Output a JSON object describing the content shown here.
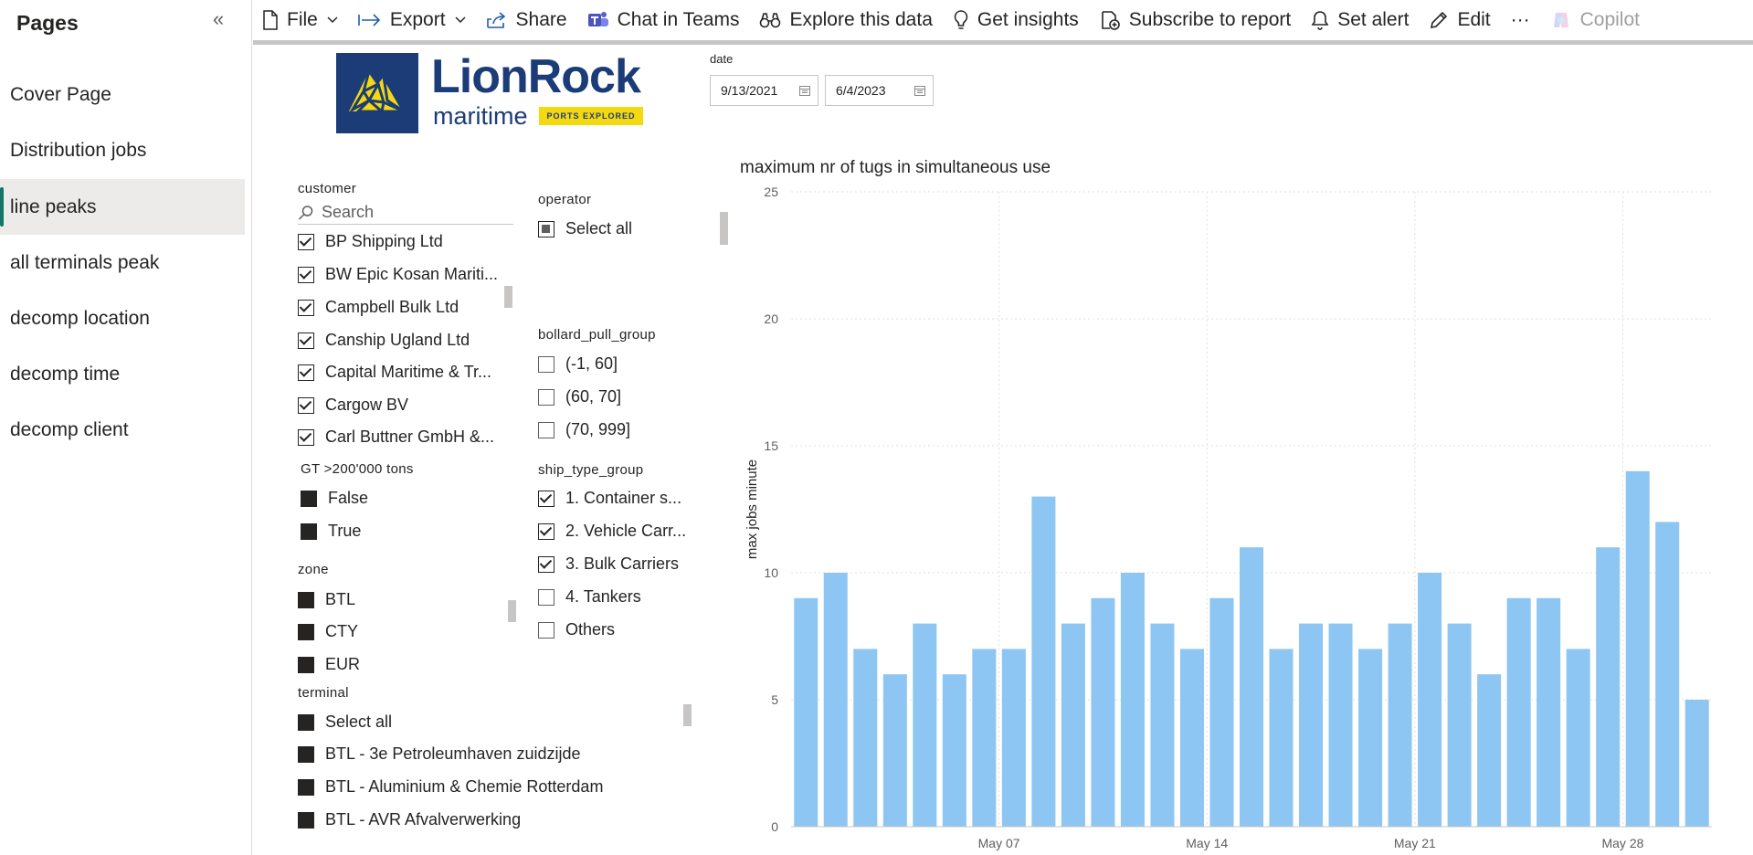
{
  "pages_pane": {
    "title": "Pages",
    "collapse_glyph": "«",
    "items": [
      {
        "label": "Cover Page",
        "active": false
      },
      {
        "label": "Distribution jobs",
        "active": false
      },
      {
        "label": "line peaks",
        "active": true
      },
      {
        "label": "all terminals peak",
        "active": false
      },
      {
        "label": "decomp location",
        "active": false
      },
      {
        "label": "decomp time",
        "active": false
      },
      {
        "label": "decomp client",
        "active": false
      }
    ]
  },
  "toolbar": {
    "file": "File",
    "export": "Export",
    "share": "Share",
    "chat_in_teams": "Chat in Teams",
    "explore": "Explore this data",
    "insights": "Get insights",
    "subscribe": "Subscribe to report",
    "alert": "Set alert",
    "edit": "Edit",
    "more": "···",
    "copilot": "Copilot"
  },
  "logo": {
    "word": "LionRock",
    "sub": "maritime",
    "tag": "PORTS EXPLORED",
    "brand_color": "#1c3c78",
    "tag_color": "#f4d910"
  },
  "date_slicer": {
    "label": "date",
    "start": "9/13/2021",
    "end": "6/4/2023"
  },
  "customer_slicer": {
    "title": "customer",
    "search_placeholder": "Search",
    "options": [
      "BP Shipping Ltd",
      "BW Epic Kosan Mariti...",
      "Campbell Bulk Ltd",
      "Canship Ugland Ltd",
      "Capital Maritime & Tr...",
      "Cargow BV",
      "Carl Buttner GmbH &..."
    ]
  },
  "gt_slicer": {
    "title": "GT >200'000 tons",
    "options": [
      "False",
      "True"
    ]
  },
  "zone_slicer": {
    "title": "zone",
    "options": [
      "BTL",
      "CTY",
      "EUR"
    ]
  },
  "terminal_slicer": {
    "title": "terminal",
    "options": [
      "Select all",
      "BTL - 3e Petroleumhaven zuidzijde",
      "BTL - Aluminium & Chemie Rotterdam",
      "BTL - AVR Afvalverwerking"
    ]
  },
  "operator_slicer": {
    "title": "operator",
    "options": [
      "Select all"
    ]
  },
  "bollard_slicer": {
    "title": "bollard_pull_group",
    "options": [
      "(-1, 60]",
      "(60, 70]",
      "(70, 999]"
    ]
  },
  "ship_type_slicer": {
    "title": "ship_type_group",
    "options": [
      {
        "label": "1. Container s...",
        "checked": true
      },
      {
        "label": "2. Vehicle Carr...",
        "checked": true
      },
      {
        "label": "3. Bulk Carriers",
        "checked": true
      },
      {
        "label": "4. Tankers",
        "checked": false
      },
      {
        "label": "Others",
        "checked": false
      }
    ]
  },
  "chart_data": {
    "type": "bar",
    "title": "maximum nr of tugs in simultaneous use",
    "xlabel": "",
    "ylabel": "max jobs minute",
    "ylim": [
      0,
      25
    ],
    "yticks": [
      0,
      5,
      10,
      15,
      20,
      25
    ],
    "grid": true,
    "bar_color": "#8dc6f2",
    "x_tick_labels": [
      {
        "label": "May 07",
        "index": 6.5
      },
      {
        "label": "May 14",
        "index": 13.5
      },
      {
        "label": "May 21",
        "index": 20.5
      },
      {
        "label": "May 28",
        "index": 27.5
      }
    ],
    "values": [
      9,
      10,
      7,
      6,
      8,
      6,
      7,
      7,
      13,
      8,
      9,
      10,
      8,
      7,
      9,
      11,
      7,
      8,
      8,
      7,
      8,
      10,
      8,
      6,
      9,
      9,
      7,
      11,
      14,
      12,
      5
    ]
  }
}
